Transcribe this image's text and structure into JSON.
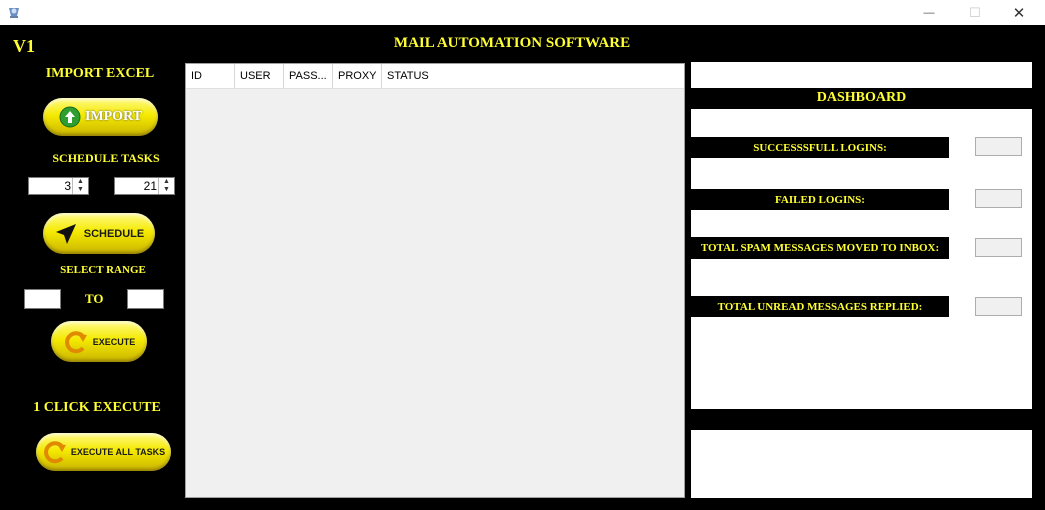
{
  "window": {
    "minimize_glyph": "—",
    "maximize_glyph": "☐",
    "close_glyph": "✕"
  },
  "version": "V1",
  "app_title": "MAIL AUTOMATION SOFTWARE",
  "sidebar": {
    "import_heading": "IMPORT EXCEL",
    "import_button": "IMPORT",
    "schedule_heading": "SCHEDULE TASKS",
    "hour_value": "3",
    "minute_value": "21",
    "schedule_button": "SCHEDULE",
    "range_heading": "SELECT RANGE",
    "range_to": "TO",
    "range_from_value": "",
    "range_end_value": "",
    "execute_button": "EXECUTE",
    "one_click_heading": "1 CLICK EXECUTE",
    "execute_all_button": "EXECUTE ALL TASKS"
  },
  "table": {
    "columns": [
      "ID",
      "USER",
      "PASS...",
      "PROXY",
      "STATUS"
    ],
    "rows": []
  },
  "dashboard": {
    "title": "DASHBOARD",
    "stats": [
      {
        "label": "SUCCESSSFULL LOGINS:",
        "value": ""
      },
      {
        "label": "FAILED LOGINS:",
        "value": ""
      },
      {
        "label": "TOTAL SPAM MESSAGES MOVED TO INBOX:",
        "value": ""
      },
      {
        "label": "TOTAL UNREAD MESSAGES REPLIED:",
        "value": ""
      }
    ]
  },
  "colors": {
    "background": "#000000",
    "label_yellow": "#ffff33",
    "button_yellow": "#f5ea00",
    "import_icon_green": "#2e9e2e"
  }
}
